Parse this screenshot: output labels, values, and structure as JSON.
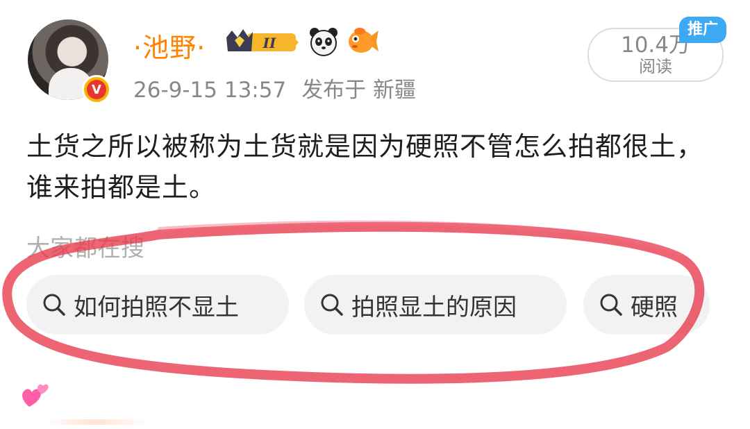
{
  "user": {
    "name": "·池野·",
    "verified_label": "V",
    "level_badge": "II",
    "avatar_icon": "user-avatar"
  },
  "post": {
    "time": "26-9-15 13:57",
    "location": "发布于 新疆",
    "text": "土货之所以被称为土货就是因为硬照不管怎么拍都很土，谁来拍都是土。"
  },
  "reads": {
    "count": "10.4万",
    "label": "阅读"
  },
  "promo_tag": "推广",
  "search_section": {
    "title": "大家都在搜",
    "chips": [
      {
        "label": "如何拍照不显土",
        "icon": "search-icon"
      },
      {
        "label": "拍照显土的原因",
        "icon": "search-icon"
      },
      {
        "label": "硬照",
        "icon": "search-icon"
      }
    ]
  },
  "colors": {
    "username": "#ff8200",
    "annotation_circle": "#e8394a",
    "promo_tag": "#3da9f4"
  }
}
